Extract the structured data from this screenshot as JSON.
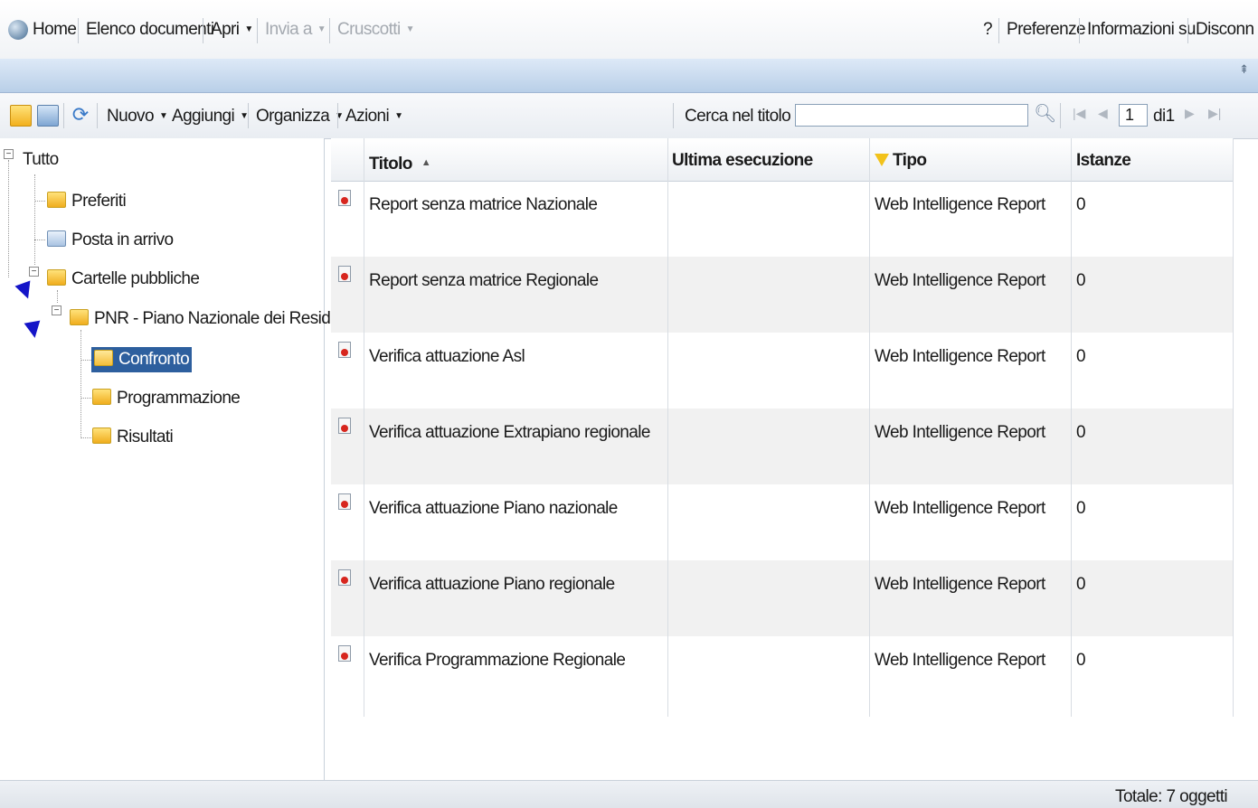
{
  "topnav": {
    "home": "Home",
    "documents": "Elenco documenti",
    "open": "Apri",
    "send_to": "Invia a",
    "dashboards": "Cruscotti",
    "help": "?",
    "preferences": "Preferenze",
    "about": "Informazioni su",
    "logout": "Disconn"
  },
  "toolbar": {
    "new": "Nuovo",
    "add": "Aggiungi",
    "organize": "Organizza",
    "actions": "Azioni",
    "search_scope": "Cerca nel titolo",
    "search_value": "",
    "page_value": "1",
    "page_of": "di1"
  },
  "tree": {
    "root": "Tutto",
    "favorites": "Preferiti",
    "inbox": "Posta in arrivo",
    "public_folders": "Cartelle pubbliche",
    "pnr": "PNR - Piano Nazionale dei Residui",
    "confronto": "Confronto",
    "programmazione": "Programmazione",
    "risultati": "Risultati"
  },
  "table": {
    "headers": {
      "title": "Titolo",
      "last_run": "Ultima esecuzione",
      "type": "Tipo",
      "instances": "Istanze"
    },
    "rows": [
      {
        "title": "Report senza matrice Nazionale",
        "last_run": "",
        "type": "Web Intelligence Report",
        "instances": "0"
      },
      {
        "title": "Report senza matrice Regionale",
        "last_run": "",
        "type": "Web Intelligence Report",
        "instances": "0"
      },
      {
        "title": "Verifica attuazione Asl",
        "last_run": "",
        "type": "Web Intelligence Report",
        "instances": "0"
      },
      {
        "title": "Verifica attuazione Extrapiano regionale",
        "last_run": "",
        "type": "Web Intelligence Report",
        "instances": "0"
      },
      {
        "title": "Verifica attuazione Piano nazionale",
        "last_run": "",
        "type": "Web Intelligence Report",
        "instances": "0"
      },
      {
        "title": "Verifica attuazione Piano regionale",
        "last_run": "",
        "type": "Web Intelligence Report",
        "instances": "0"
      },
      {
        "title": "Verifica Programmazione Regionale",
        "last_run": "",
        "type": "Web Intelligence Report",
        "instances": "0"
      }
    ]
  },
  "footer": {
    "total": "Totale: 7 oggetti"
  },
  "colors": {
    "selection": "#2d5f9e",
    "strip": "#c7d9ee",
    "annotation_arrow": "#1515c8"
  }
}
